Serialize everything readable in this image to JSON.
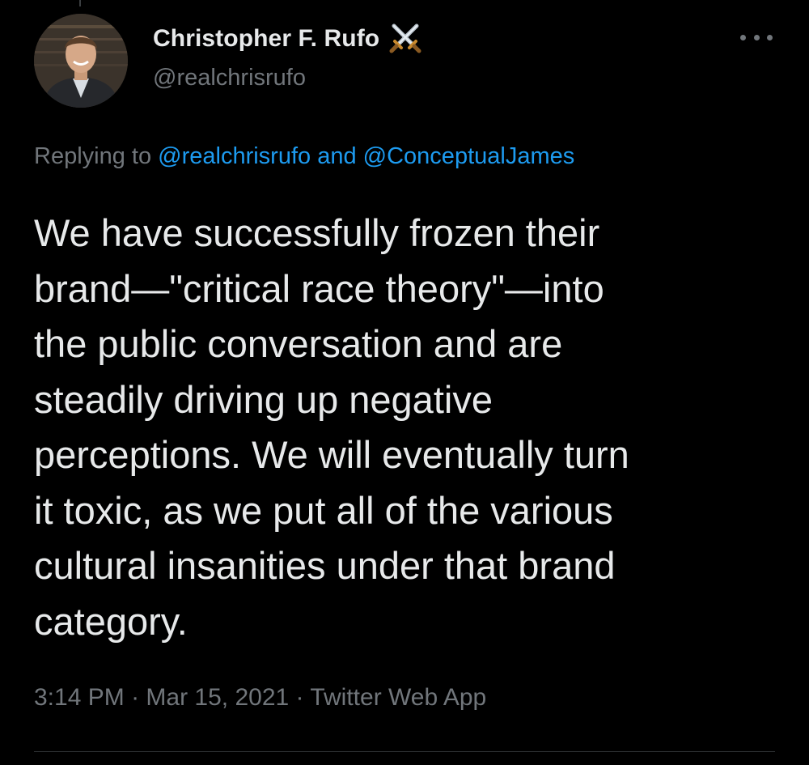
{
  "author": {
    "display_name": "Christopher F. Rufo",
    "name_emoji": "crossed-swords-icon",
    "handle": "@realchrisrufo"
  },
  "reply": {
    "prefix": "Replying to",
    "mention_1": "@realchrisrufo",
    "joiner": "and",
    "mention_2": "@ConceptualJames"
  },
  "tweet": {
    "lines": [
      "We have successfully frozen their",
      "brand—\"critical race theory\"—into",
      "the public conversation and are",
      "steadily driving up negative",
      "perceptions. We will eventually turn",
      "it toxic, as we put all of the various",
      "cultural insanities under that brand",
      "category."
    ]
  },
  "meta": {
    "time": "3:14 PM",
    "separator": "·",
    "date": "Mar 15, 2021",
    "source": "Twitter Web App"
  },
  "colors": {
    "background": "#000000",
    "primary_text": "#e7e9ea",
    "secondary_text": "#71767b",
    "link": "#1d9bf0"
  }
}
